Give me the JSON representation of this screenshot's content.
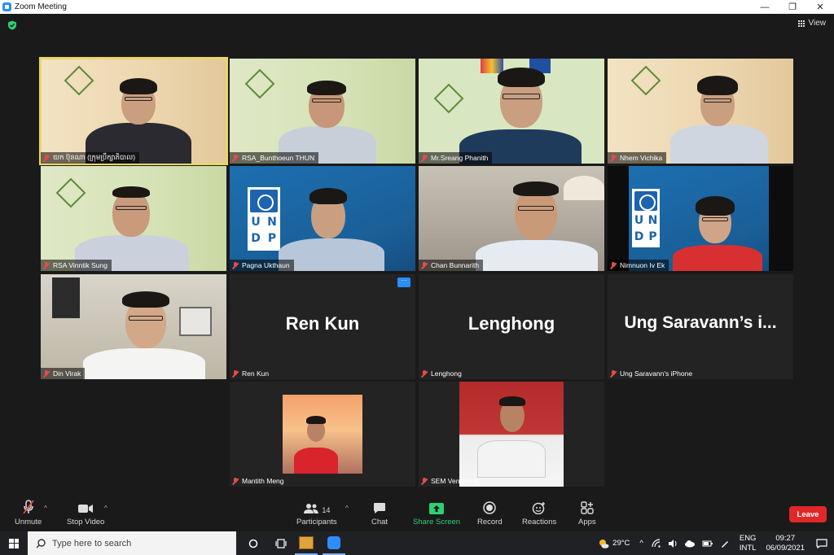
{
  "window": {
    "title": "Zoom Meeting",
    "minimize_glyph": "—",
    "maximize_glyph": "❐",
    "close_glyph": "✕"
  },
  "meeting": {
    "view_label": "View",
    "encryption_icon": "shield-check-icon",
    "active_speaker_color": "#e8d66a"
  },
  "participants": [
    {
      "name": "យក ប៊ុនណា (ក្រុមប្រឹក្សាភិបាល)",
      "video": true,
      "muted": true
    },
    {
      "name": "RSA_Bunthoeun THUN",
      "video": true,
      "muted": true
    },
    {
      "name": "Mr.Sreang Phanith",
      "video": true,
      "muted": true
    },
    {
      "name": "Nhem Vichika",
      "video": true,
      "muted": true
    },
    {
      "name": "RSA Vinntik Sung",
      "video": true,
      "muted": true
    },
    {
      "name": "Pagna Ukthaun",
      "video": true,
      "muted": true
    },
    {
      "name": "Chan Bunnarith",
      "video": true,
      "muted": true
    },
    {
      "name": "Nimnuon Iv Ek",
      "video": true,
      "muted": true
    },
    {
      "name": "Din Virak",
      "video": true,
      "muted": true
    },
    {
      "name": "Ren Kun",
      "video": false,
      "muted": true,
      "display": "Ren Kun"
    },
    {
      "name": "Lenghong",
      "video": false,
      "muted": true,
      "display": "Lenghong"
    },
    {
      "name": "Ung Saravann's iPhone",
      "video": false,
      "muted": true,
      "display": "Ung Saravann’s i..."
    },
    {
      "name": "Mantith Meng",
      "video": false,
      "muted": true
    },
    {
      "name": "SEM Vengheng",
      "video": false,
      "muted": true
    }
  ],
  "tile_more_glyph": "···",
  "undp_letters": [
    "U",
    "N",
    "D",
    "P"
  ],
  "controls": {
    "unmute": "Unmute",
    "stop_video": "Stop Video",
    "participants": "Participants",
    "participants_count": "14",
    "chat": "Chat",
    "share_screen": "Share Screen",
    "record": "Record",
    "reactions": "Reactions",
    "apps": "Apps",
    "leave": "Leave",
    "caret": "^",
    "accent_green": "#2fcf73",
    "leave_color": "#e02828"
  },
  "taskbar": {
    "search_placeholder": "Type here to search",
    "weather": "29°C",
    "lang_top": "ENG",
    "lang_bottom": "INTL",
    "time": "09:27",
    "date": "06/09/2021",
    "tray_caret": "^"
  }
}
